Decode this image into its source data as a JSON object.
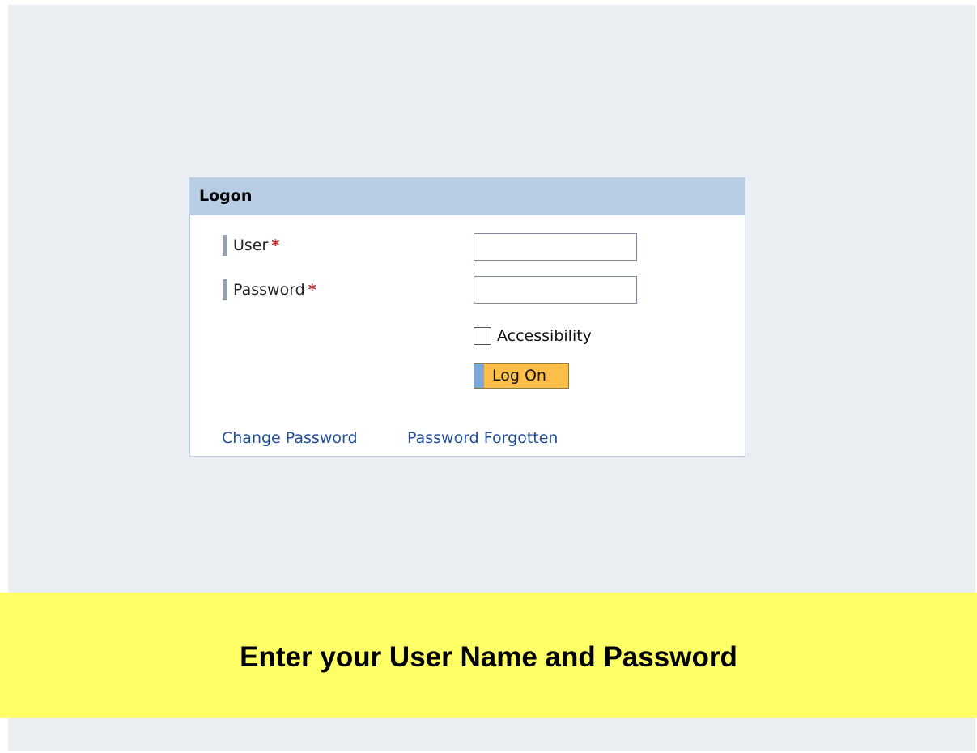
{
  "logon": {
    "title": "Logon",
    "user_label": "User",
    "password_label": "Password",
    "required_marker": "*",
    "user_value": "",
    "password_value": "",
    "accessibility_label": "Accessibility",
    "accessibility_checked": false,
    "logon_button_label": "Log On",
    "change_password_link": "Change Password",
    "password_forgotten_link": "Password Forgotten"
  },
  "banner": {
    "text": "Enter your User Name and Password"
  },
  "colors": {
    "background": "#eaeef2",
    "header": "#b9cde4",
    "button": "#ffbe4a",
    "banner": "#ffff66",
    "link": "#1f4d96",
    "required": "#c2262b"
  }
}
